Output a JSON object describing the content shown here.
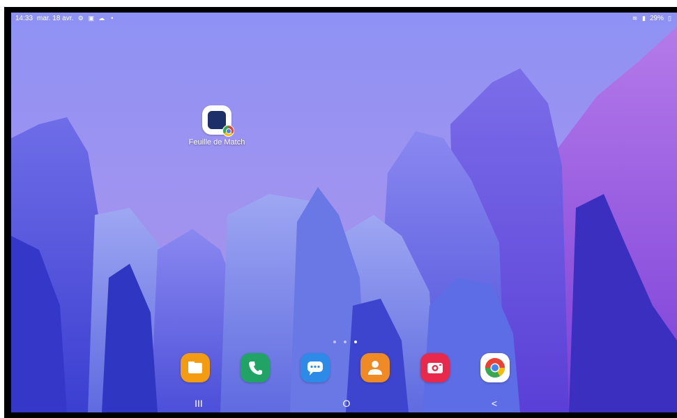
{
  "status_bar": {
    "time": "14:33",
    "date": "mar. 18 avr.",
    "battery": "29%",
    "left_icons": [
      "settings-icon",
      "gallery-icon",
      "cloud-icon",
      "dot-icon"
    ],
    "right_icons": [
      "wifi-icon",
      "signal-icon",
      "battery-icon"
    ]
  },
  "home": {
    "apps": [
      {
        "label": "Feuille de Match",
        "icon": "feuille-de-match-icon",
        "badge": "chrome-badge-icon"
      }
    ],
    "page_indicator": {
      "pages": 3,
      "active": 3
    }
  },
  "dock": {
    "apps": [
      {
        "name": "my-files",
        "icon": "folder-icon",
        "color": "#f39c12"
      },
      {
        "name": "phone",
        "icon": "phone-icon",
        "color": "#21a366"
      },
      {
        "name": "messages",
        "icon": "messages-icon",
        "color": "#2d8ae6"
      },
      {
        "name": "contacts",
        "icon": "contacts-icon",
        "color": "#f08a24"
      },
      {
        "name": "camera",
        "icon": "camera-icon",
        "color": "#e8294b"
      },
      {
        "name": "chrome",
        "icon": "chrome-icon",
        "color": "#ffffff"
      }
    ]
  },
  "nav_bar": {
    "recents": "III",
    "home": "O",
    "back": "<"
  }
}
